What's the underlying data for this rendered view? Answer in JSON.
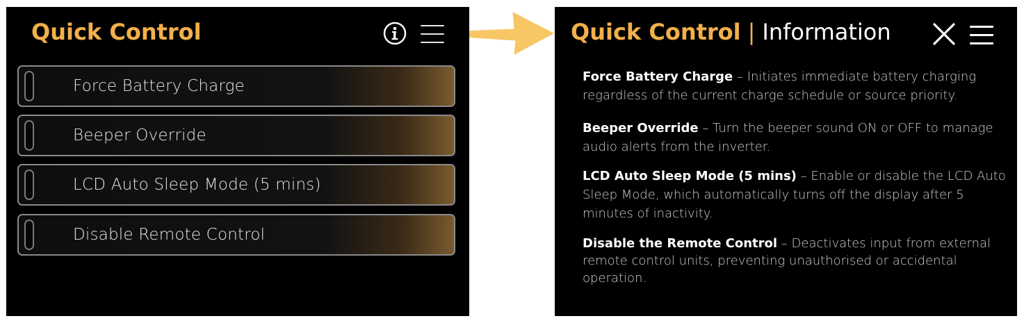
{
  "colors": {
    "accent": "#f2b04a",
    "panel_bg": "#000000",
    "arrow": "#f7c766"
  },
  "left_screen": {
    "title": "Quick Control",
    "icons": [
      "info-icon",
      "hamburger-menu-icon"
    ],
    "items": [
      {
        "label": "Force Battery Charge",
        "enabled": false
      },
      {
        "label": "Beeper Override",
        "enabled": false
      },
      {
        "label": "LCD Auto Sleep Mode (5 mins)",
        "enabled": false
      },
      {
        "label": "Disable Remote Control",
        "enabled": false
      }
    ]
  },
  "right_screen": {
    "title": "Quick Control",
    "separator": "|",
    "subtitle": "Information",
    "icons": [
      "close-icon",
      "hamburger-menu-icon"
    ],
    "entries": [
      {
        "term": "Force Battery Charge",
        "description": " – Initiates immediate battery charging regardless of the current charge schedule or source priority."
      },
      {
        "term": "Beeper Override",
        "description": "  – Turn the beeper sound ON or OFF to manage audio alerts from the inverter."
      },
      {
        "term": "LCD Auto Sleep Mode (5 mins)",
        "description": " – Enable or disable the LCD Auto Sleep Mode, which automatically turns off the display after 5 minutes of inactivity."
      },
      {
        "term": "Disable the Remote Control",
        "description": " – Deactivates input from external remote control units, preventing unauthorised or accidental operation."
      }
    ]
  }
}
